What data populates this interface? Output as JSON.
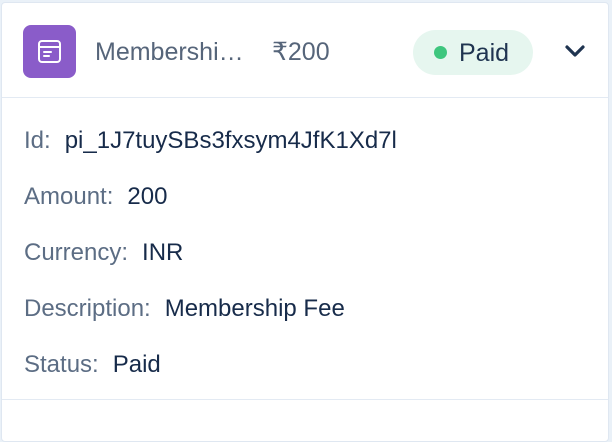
{
  "header": {
    "icon": "receipt-icon",
    "title": "Membership Fee",
    "amount": "₹200",
    "status": "Paid",
    "status_color": "#3ec67e",
    "icon_bg": "#8a5cc9"
  },
  "details": {
    "id": {
      "label": "Id:",
      "value": "pi_1J7tuySBs3fxsym4JfK1Xd7l"
    },
    "amount": {
      "label": "Amount:",
      "value": "200"
    },
    "currency": {
      "label": "Currency:",
      "value": "INR"
    },
    "description": {
      "label": "Description:",
      "value": "Membership Fee"
    },
    "status": {
      "label": "Status:",
      "value": "Paid"
    }
  }
}
